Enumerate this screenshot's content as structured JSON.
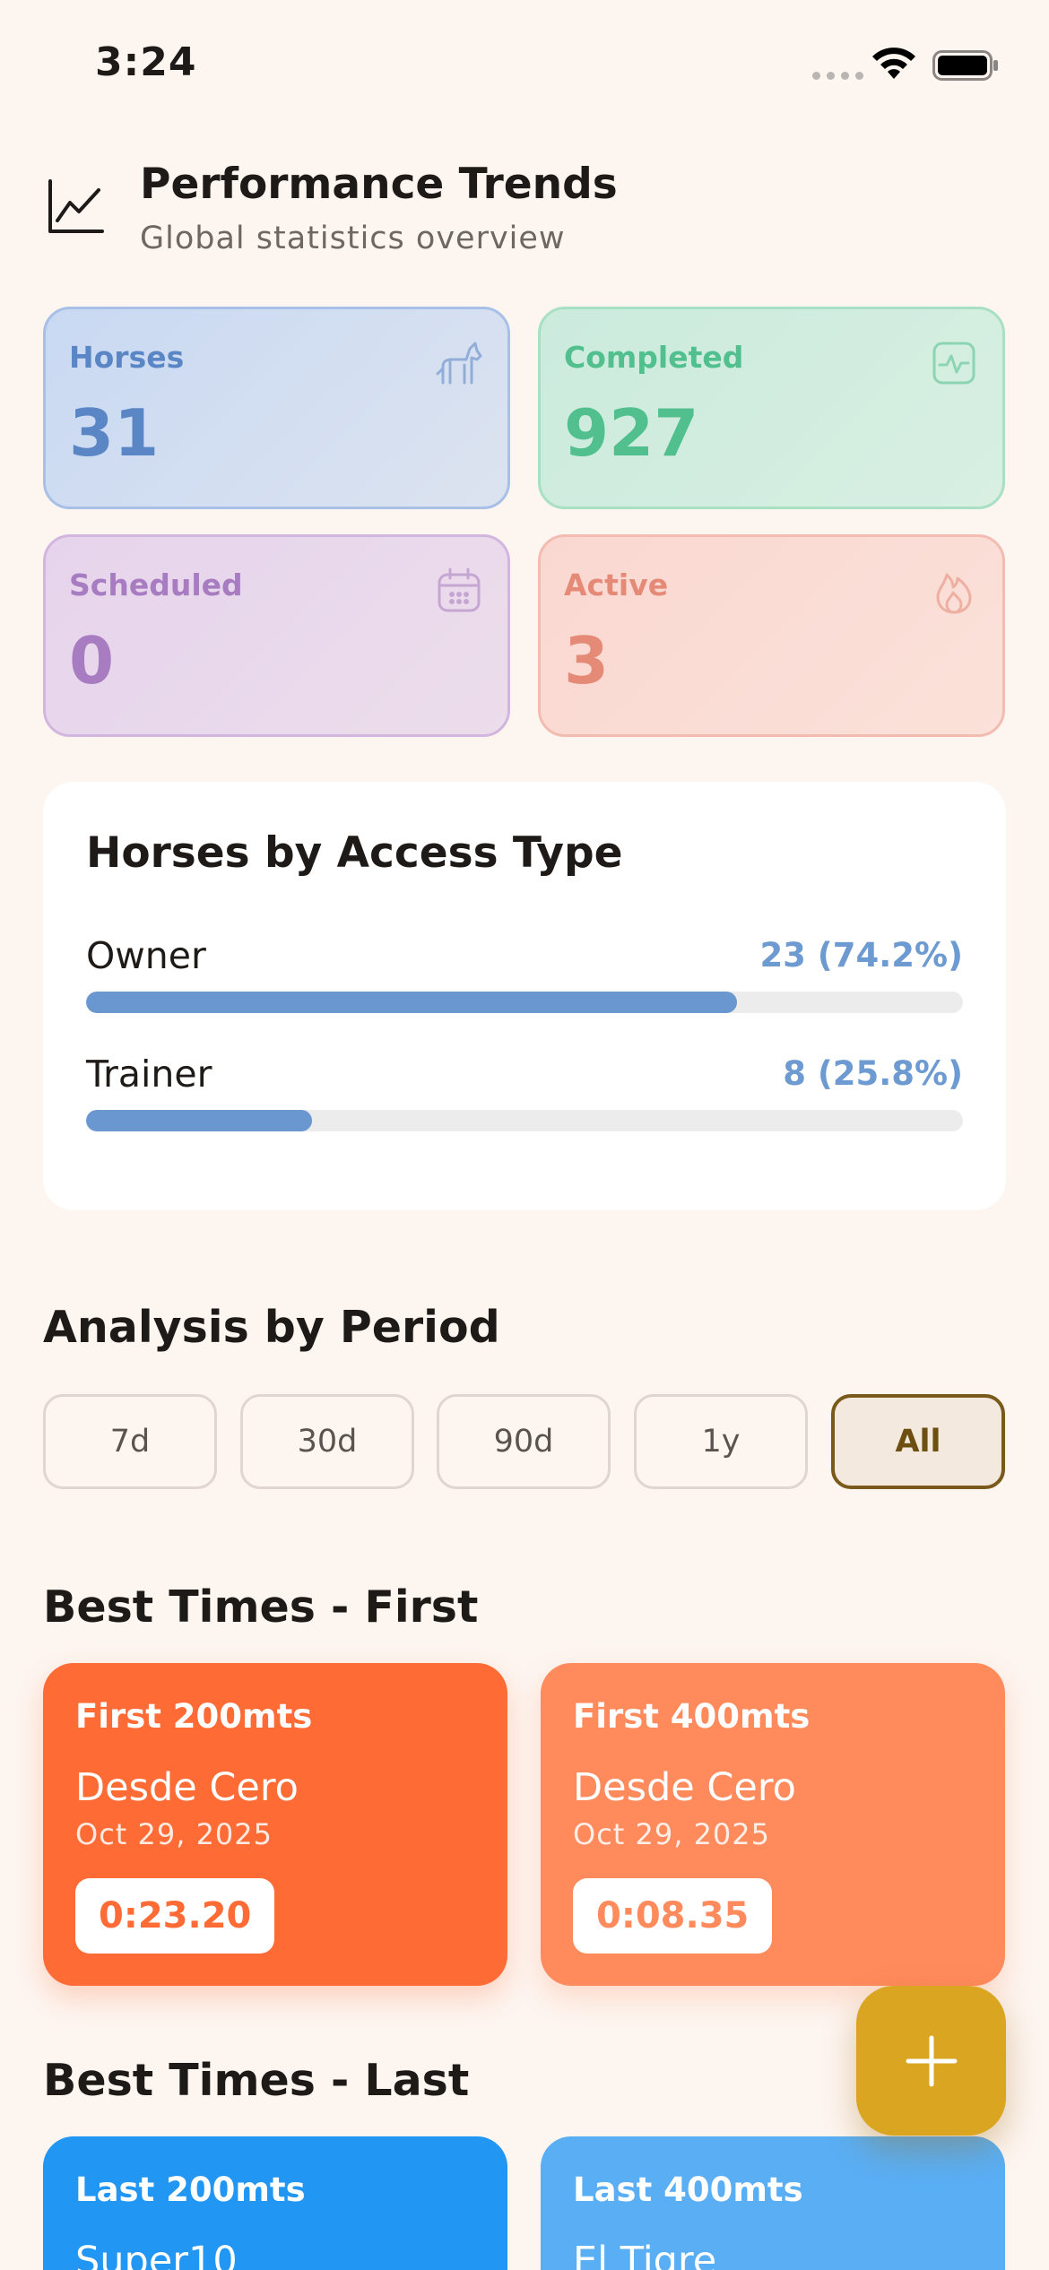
{
  "status_bar": {
    "time": "3:24"
  },
  "header": {
    "title": "Performance Trends",
    "subtitle": "Global statistics overview",
    "icon": "trend-chart-icon"
  },
  "stats": [
    {
      "label": "Horses",
      "value": "31",
      "icon": "horse-icon",
      "color": "#5B86C6"
    },
    {
      "label": "Completed",
      "value": "927",
      "icon": "activity-icon",
      "color": "#52BF8E"
    },
    {
      "label": "Scheduled",
      "value": "0",
      "icon": "calendar-icon",
      "color": "#A77CC1"
    },
    {
      "label": "Active",
      "value": "3",
      "icon": "flame-icon",
      "color": "#E68A78"
    }
  ],
  "access_type": {
    "title": "Horses by Access Type",
    "rows": [
      {
        "label": "Owner",
        "value": "23 (74.2%)",
        "fraction": 0.742
      },
      {
        "label": "Trainer",
        "value": "8 (25.8%)",
        "fraction": 0.258
      }
    ]
  },
  "period": {
    "title": "Analysis by Period",
    "options": [
      "7d",
      "30d",
      "90d",
      "1y",
      "All"
    ],
    "selected": "All"
  },
  "best_first": {
    "title": "Best Times - First",
    "cards": [
      {
        "label": "First 200mts",
        "horse": "Desde Cero",
        "date": "Oct 29, 2025",
        "time": "0:23.20",
        "color": "#FF6B35"
      },
      {
        "label": "First 400mts",
        "horse": "Desde Cero",
        "date": "Oct 29, 2025",
        "time": "0:08.35",
        "color": "#FF8A5C"
      }
    ]
  },
  "best_last": {
    "title": "Best Times - Last",
    "cards": [
      {
        "label": "Last 200mts",
        "horse": "Super10",
        "color": "#2196F3"
      },
      {
        "label": "Last 400mts",
        "horse": "El Tigre",
        "color": "#5AAEF3"
      }
    ]
  },
  "fab": {
    "icon": "plus-icon",
    "color": "#DAA520"
  }
}
